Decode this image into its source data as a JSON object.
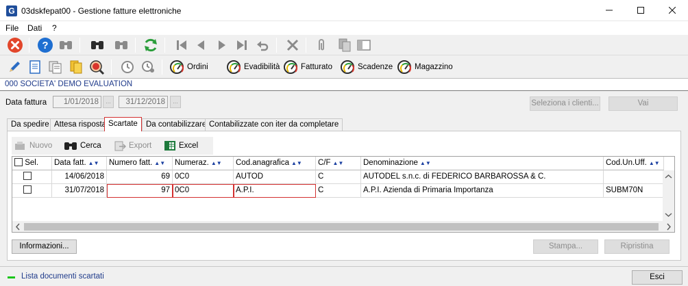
{
  "window": {
    "title": "03dskfepat00 - Gestione fatture elettroniche",
    "app_icon": "G"
  },
  "menu": [
    "File",
    "Dati",
    "?"
  ],
  "toolbar2": {
    "ordini": "Ordini",
    "evadibilita": "Evadibilità",
    "fatturato": "Fatturato",
    "scadenze": "Scadenze",
    "magazzino": "Magazzino"
  },
  "company": "000 SOCIETA' DEMO EVALUATION",
  "filters": {
    "date_label": "Data fattura",
    "date_from": "1/01/2018",
    "date_to": "31/12/2018",
    "dots": "...",
    "select_clients": "Seleziona i clienti...",
    "go": "Vai"
  },
  "tabs": [
    "Da spedire",
    "Attesa risposta",
    "Scartate",
    "Da contabilizzare",
    "Contabilizzate con iter da completare"
  ],
  "grid_toolbar": {
    "new": "Nuovo",
    "search": "Cerca",
    "export": "Export",
    "excel": "Excel"
  },
  "columns": [
    "Sel.",
    "Data fatt.",
    "Numero fatt.",
    "Numeraz.",
    "Cod.anagrafica",
    "C/F",
    "Denominazione",
    "Cod.Un.Uff."
  ],
  "rows": [
    {
      "date": "14/06/2018",
      "number": "69",
      "numeraz": "0C0",
      "cod": "AUTOD",
      "cf": "C",
      "name": "AUTODEL s.n.c. di FEDERICO BARBAROSSA & C.",
      "cuu": ""
    },
    {
      "date": "31/07/2018",
      "number": "97",
      "numeraz": "0C0",
      "cod": "A.P.I.",
      "cf": "C",
      "name": "A.P.I. Azienda di Primaria Importanza",
      "cuu": "SUBM70N"
    }
  ],
  "buttons": {
    "info": "Informazioni...",
    "print": "Stampa...",
    "restore": "Ripristina",
    "exit": "Esci"
  },
  "status": "Lista documenti scartati"
}
